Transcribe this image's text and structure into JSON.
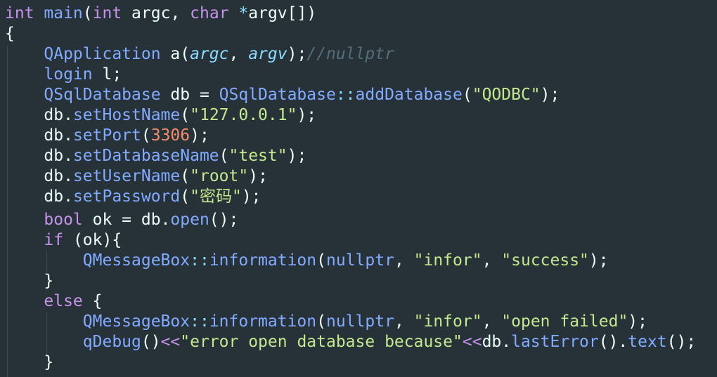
{
  "editor": {
    "language": "cpp",
    "colors": {
      "background": "#263238",
      "keyword": "#c792ea",
      "function": "#82aaff",
      "string": "#c3e88d",
      "number": "#f78c6c",
      "comment": "#546e7a",
      "punctuation": "#89ddff",
      "text": "#eeffff"
    },
    "lines": [
      [
        {
          "t": "int",
          "k": "kw"
        },
        {
          "t": " main",
          "k": "fn"
        },
        {
          "t": "(",
          "k": "var"
        },
        {
          "t": "int",
          "k": "kw"
        },
        {
          "t": " argc",
          "k": "var"
        },
        {
          "t": ", ",
          "k": "var"
        },
        {
          "t": "char",
          "k": "kw"
        },
        {
          "t": " ",
          "k": "var"
        },
        {
          "t": "*",
          "k": "punct"
        },
        {
          "t": "argv",
          "k": "var"
        },
        {
          "t": "[])",
          "k": "var"
        }
      ],
      [
        {
          "t": "{",
          "k": "var"
        }
      ],
      [
        {
          "t": "    ",
          "k": "var"
        },
        {
          "t": "QApplication",
          "k": "fn"
        },
        {
          "t": " a(",
          "k": "var"
        },
        {
          "t": "argc",
          "k": "param"
        },
        {
          "t": ", ",
          "k": "var"
        },
        {
          "t": "argv",
          "k": "param"
        },
        {
          "t": ");",
          "k": "var"
        },
        {
          "t": "//nullptr",
          "k": "comment"
        }
      ],
      [
        {
          "t": "    ",
          "k": "var"
        },
        {
          "t": "login",
          "k": "fn"
        },
        {
          "t": " l;",
          "k": "var"
        }
      ],
      [
        {
          "t": "    ",
          "k": "var"
        },
        {
          "t": "QSqlDatabase",
          "k": "fn"
        },
        {
          "t": " db = ",
          "k": "var"
        },
        {
          "t": "QSqlDatabase",
          "k": "fn"
        },
        {
          "t": "::",
          "k": "punct"
        },
        {
          "t": "addDatabase",
          "k": "fn"
        },
        {
          "t": "(",
          "k": "var"
        },
        {
          "t": "\"QODBC\"",
          "k": "str"
        },
        {
          "t": ");",
          "k": "var"
        }
      ],
      [
        {
          "t": "    db.",
          "k": "var"
        },
        {
          "t": "setHostName",
          "k": "fn"
        },
        {
          "t": "(",
          "k": "var"
        },
        {
          "t": "\"127.0.0.1\"",
          "k": "str"
        },
        {
          "t": ");",
          "k": "var"
        }
      ],
      [
        {
          "t": "    db.",
          "k": "var"
        },
        {
          "t": "setPort",
          "k": "fn"
        },
        {
          "t": "(",
          "k": "var"
        },
        {
          "t": "3306",
          "k": "num"
        },
        {
          "t": ");",
          "k": "var"
        }
      ],
      [
        {
          "t": "    db.",
          "k": "var"
        },
        {
          "t": "setDatabaseName",
          "k": "fn"
        },
        {
          "t": "(",
          "k": "var"
        },
        {
          "t": "\"test\"",
          "k": "str"
        },
        {
          "t": ");",
          "k": "var"
        }
      ],
      [
        {
          "t": "    db.",
          "k": "var"
        },
        {
          "t": "setUserName",
          "k": "fn"
        },
        {
          "t": "(",
          "k": "var"
        },
        {
          "t": "\"root\"",
          "k": "str"
        },
        {
          "t": ");",
          "k": "var"
        }
      ],
      [
        {
          "t": "    db.",
          "k": "var"
        },
        {
          "t": "setPassword",
          "k": "fn"
        },
        {
          "t": "(",
          "k": "var"
        },
        {
          "t": "\"密码\"",
          "k": "str"
        },
        {
          "t": ");",
          "k": "var"
        }
      ],
      [
        {
          "t": "    ",
          "k": "var"
        },
        {
          "t": "bool",
          "k": "kw"
        },
        {
          "t": " ok = db.",
          "k": "var"
        },
        {
          "t": "open",
          "k": "fn"
        },
        {
          "t": "();",
          "k": "var"
        }
      ],
      [
        {
          "t": "    ",
          "k": "var"
        },
        {
          "t": "if",
          "k": "kw"
        },
        {
          "t": " (ok){",
          "k": "var"
        }
      ],
      [
        {
          "t": "        ",
          "k": "var"
        },
        {
          "t": "QMessageBox",
          "k": "fn"
        },
        {
          "t": "::",
          "k": "punct"
        },
        {
          "t": "information",
          "k": "fn"
        },
        {
          "t": "(",
          "k": "var"
        },
        {
          "t": "nullptr",
          "k": "fn"
        },
        {
          "t": ", ",
          "k": "var"
        },
        {
          "t": "\"infor\"",
          "k": "str"
        },
        {
          "t": ", ",
          "k": "var"
        },
        {
          "t": "\"success\"",
          "k": "str"
        },
        {
          "t": ");",
          "k": "var"
        }
      ],
      [
        {
          "t": "    }",
          "k": "var"
        }
      ],
      [
        {
          "t": "    ",
          "k": "var"
        },
        {
          "t": "else",
          "k": "kw"
        },
        {
          "t": " {",
          "k": "var"
        }
      ],
      [
        {
          "t": "        ",
          "k": "var"
        },
        {
          "t": "QMessageBox",
          "k": "fn"
        },
        {
          "t": "::",
          "k": "punct"
        },
        {
          "t": "information",
          "k": "fn"
        },
        {
          "t": "(",
          "k": "var"
        },
        {
          "t": "nullptr",
          "k": "fn"
        },
        {
          "t": ", ",
          "k": "var"
        },
        {
          "t": "\"infor\"",
          "k": "str"
        },
        {
          "t": ", ",
          "k": "var"
        },
        {
          "t": "\"open failed\"",
          "k": "str"
        },
        {
          "t": ");",
          "k": "var"
        }
      ],
      [
        {
          "t": "        ",
          "k": "var"
        },
        {
          "t": "qDebug",
          "k": "fn"
        },
        {
          "t": "()",
          "k": "var"
        },
        {
          "t": "<<",
          "k": "kw"
        },
        {
          "t": "\"error open database because\"",
          "k": "str"
        },
        {
          "t": "<<",
          "k": "kw"
        },
        {
          "t": "db.",
          "k": "var"
        },
        {
          "t": "lastError",
          "k": "fn"
        },
        {
          "t": "().",
          "k": "var"
        },
        {
          "t": "text",
          "k": "fn"
        },
        {
          "t": "();",
          "k": "var"
        }
      ],
      [
        {
          "t": "    }",
          "k": "var"
        }
      ]
    ]
  }
}
